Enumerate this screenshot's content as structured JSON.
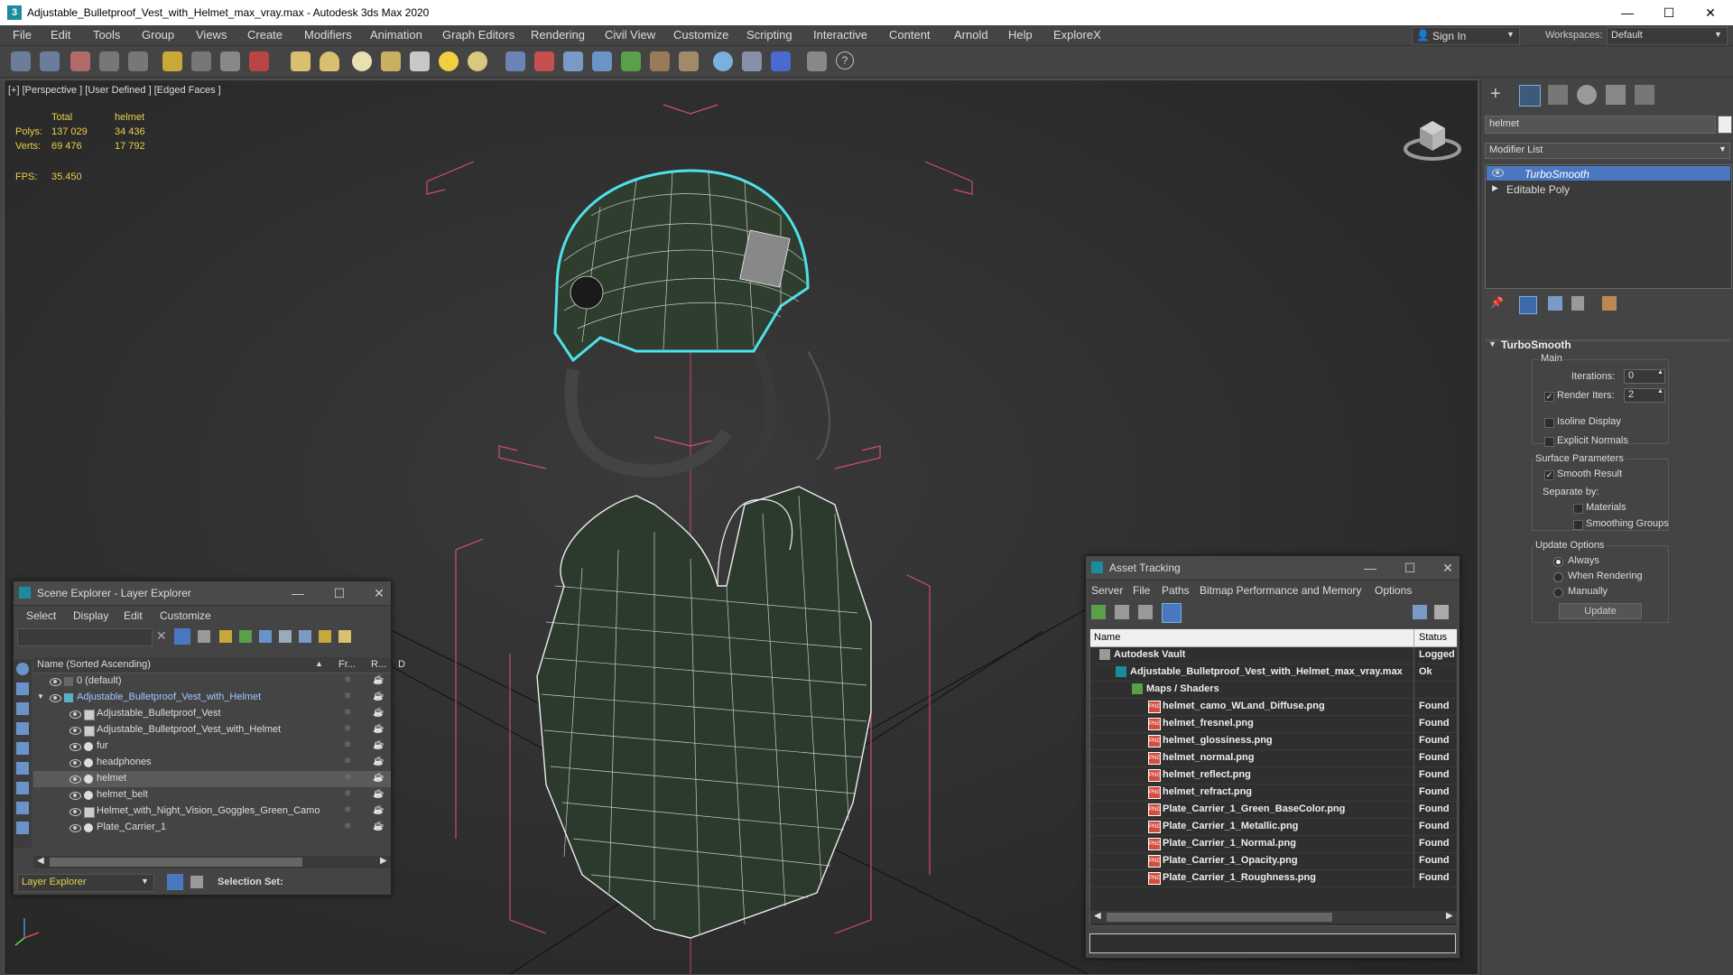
{
  "window": {
    "title": "Adjustable_Bulletproof_Vest_with_Helmet_max_vray.max - Autodesk 3ds Max 2020",
    "min": "—",
    "max": "☐",
    "close": "✕"
  },
  "menu": [
    "File",
    "Edit",
    "Tools",
    "Group",
    "Views",
    "Create",
    "Modifiers",
    "Animation",
    "Graph Editors",
    "Rendering",
    "Civil View",
    "Customize",
    "Scripting",
    "Interactive",
    "Content",
    "Arnold",
    "Help",
    "ExploreX"
  ],
  "signin": "Sign In",
  "workspaces": {
    "label": "Workspaces:",
    "value": "Default"
  },
  "viewport": {
    "label": "[+] [Perspective ] [User Defined ] [Edged Faces ]",
    "stats": {
      "col_total": "Total",
      "col_obj": "helmet",
      "polys_label": "Polys:",
      "polys_total": "137 029",
      "polys_obj": "34 436",
      "verts_label": "Verts:",
      "verts_total": "69 476",
      "verts_obj": "17 792",
      "fps_label": "FPS:",
      "fps_value": "35.450"
    }
  },
  "command_panel": {
    "object_name": "helmet",
    "modifier_list": "Modifier List",
    "stack": [
      "TurboSmooth",
      "Editable Poly"
    ],
    "turbosmooth": {
      "title": "TurboSmooth",
      "main": "Main",
      "iterations_label": "Iterations:",
      "iterations_value": "0",
      "render_iters_label": "Render Iters:",
      "render_iters_value": "2",
      "isoline": "Isoline Display",
      "explicit_normals": "Explicit Normals",
      "surface_params": "Surface Parameters",
      "smooth_result": "Smooth Result",
      "separate_by": "Separate by:",
      "materials": "Materials",
      "smoothing_groups": "Smoothing Groups",
      "update_options": "Update Options",
      "always": "Always",
      "when_rendering": "When Rendering",
      "manually": "Manually",
      "update_button": "Update"
    }
  },
  "scene_explorer": {
    "title": "Scene Explorer - Layer Explorer",
    "menu": [
      "Select",
      "Display",
      "Edit",
      "Customize"
    ],
    "col_name": "Name (Sorted Ascending)",
    "col_fr": "Fr...",
    "col_r": "R...",
    "col_d": "D",
    "rows": [
      {
        "name": "0 (default)",
        "indent": 0,
        "selected": false,
        "type": "layer"
      },
      {
        "name": "Adjustable_Bulletproof_Vest_with_Helmet",
        "indent": 0,
        "selected": false,
        "type": "layer-active"
      },
      {
        "name": "Adjustable_Bulletproof_Vest",
        "indent": 1,
        "selected": false,
        "type": "group"
      },
      {
        "name": "Adjustable_Bulletproof_Vest_with_Helmet",
        "indent": 1,
        "selected": false,
        "type": "group"
      },
      {
        "name": "fur",
        "indent": 1,
        "selected": false,
        "type": "obj"
      },
      {
        "name": "headphones",
        "indent": 1,
        "selected": false,
        "type": "obj"
      },
      {
        "name": "helmet",
        "indent": 1,
        "selected": true,
        "type": "obj"
      },
      {
        "name": "helmet_belt",
        "indent": 1,
        "selected": false,
        "type": "obj"
      },
      {
        "name": "Helmet_with_Night_Vision_Goggles_Green_Camo",
        "indent": 1,
        "selected": false,
        "type": "group"
      },
      {
        "name": "Plate_Carrier_1",
        "indent": 1,
        "selected": false,
        "type": "obj"
      }
    ],
    "footer_dropdown": "Layer Explorer",
    "selection_set": "Selection Set:"
  },
  "asset_tracking": {
    "title": "Asset Tracking",
    "menu": [
      "Server",
      "File",
      "Paths",
      "Bitmap Performance and Memory",
      "Options"
    ],
    "col_name": "Name",
    "col_status": "Status",
    "rows": [
      {
        "name": "Autodesk Vault",
        "status": "Logged",
        "indent": 0,
        "icon": "vault"
      },
      {
        "name": "Adjustable_Bulletproof_Vest_with_Helmet_max_vray.max",
        "status": "Ok",
        "indent": 1,
        "icon": "max"
      },
      {
        "name": "Maps / Shaders",
        "status": "",
        "indent": 2,
        "icon": "maps"
      },
      {
        "name": "helmet_camo_WLand_Diffuse.png",
        "status": "Found",
        "indent": 3,
        "icon": "png"
      },
      {
        "name": "helmet_fresnel.png",
        "status": "Found",
        "indent": 3,
        "icon": "png"
      },
      {
        "name": "helmet_glossiness.png",
        "status": "Found",
        "indent": 3,
        "icon": "png"
      },
      {
        "name": "helmet_normal.png",
        "status": "Found",
        "indent": 3,
        "icon": "png"
      },
      {
        "name": "helmet_reflect.png",
        "status": "Found",
        "indent": 3,
        "icon": "png"
      },
      {
        "name": "helmet_refract.png",
        "status": "Found",
        "indent": 3,
        "icon": "png"
      },
      {
        "name": "Plate_Carrier_1_Green_BaseColor.png",
        "status": "Found",
        "indent": 3,
        "icon": "png"
      },
      {
        "name": "Plate_Carrier_1_Metallic.png",
        "status": "Found",
        "indent": 3,
        "icon": "png"
      },
      {
        "name": "Plate_Carrier_1_Normal.png",
        "status": "Found",
        "indent": 3,
        "icon": "png"
      },
      {
        "name": "Plate_Carrier_1_Opacity.png",
        "status": "Found",
        "indent": 3,
        "icon": "png"
      },
      {
        "name": "Plate_Carrier_1_Roughness.png",
        "status": "Found",
        "indent": 3,
        "icon": "png"
      }
    ]
  },
  "colors": {
    "accent_blue": "#5a8fd6",
    "stats_yellow": "#e8d04a",
    "selection_cyan": "#4fe0ea",
    "bbox_pink": "#d04d76"
  }
}
